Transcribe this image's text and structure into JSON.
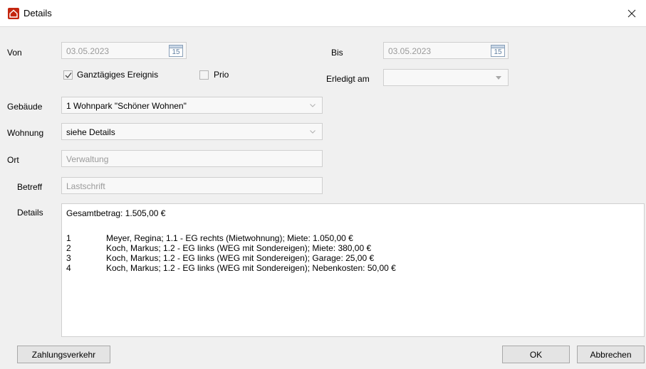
{
  "window": {
    "title": "Details"
  },
  "form": {
    "von_label": "Von",
    "von_value": "03.05.2023",
    "bis_label": "Bis",
    "bis_value": "03.05.2023",
    "calendar_day": "15",
    "allday_label": "Ganztägiges Ereignis",
    "allday_checked": true,
    "prio_label": "Prio",
    "prio_checked": false,
    "erledigt_label": "Erledigt am",
    "erledigt_value": "",
    "gebaeude_label": "Gebäude",
    "gebaeude_value": "1 Wohnpark \"Schöner Wohnen\"",
    "wohnung_label": "Wohnung",
    "wohnung_value": "siehe Details",
    "ort_label": "Ort",
    "ort_value": "Verwaltung",
    "betreff_label": "Betreff",
    "betreff_value": "Lastschrift",
    "details_label": "Details"
  },
  "details": {
    "summary": "Gesamtbetrag: 1.505,00 €",
    "entries": [
      {
        "num": "1",
        "text": "Meyer, Regina; 1.1 - EG rechts (Mietwohnung);  Miete: 1.050,00 €"
      },
      {
        "num": "2",
        "text": "Koch, Markus; 1.2 - EG links (WEG mit Sondereigen);  Miete: 380,00 €"
      },
      {
        "num": "3",
        "text": "Koch, Markus; 1.2 - EG links (WEG mit Sondereigen);  Garage: 25,00 €"
      },
      {
        "num": "4",
        "text": "Koch, Markus; 1.2 - EG links (WEG mit Sondereigen);  Nebenkosten: 50,00 €"
      }
    ]
  },
  "buttons": {
    "zahlungsverkehr": "Zahlungsverkehr",
    "ok": "OK",
    "abbrechen": "Abbrechen"
  },
  "icons": {
    "app": "house-icon",
    "close": "close-icon",
    "calendar": "calendar-icon",
    "dropdown": "chevron-down-icon",
    "check": "checkmark-icon"
  },
  "colors": {
    "app_icon": "#c4260f",
    "background": "#f0f0f0",
    "field_background": "#f8f8f8"
  }
}
